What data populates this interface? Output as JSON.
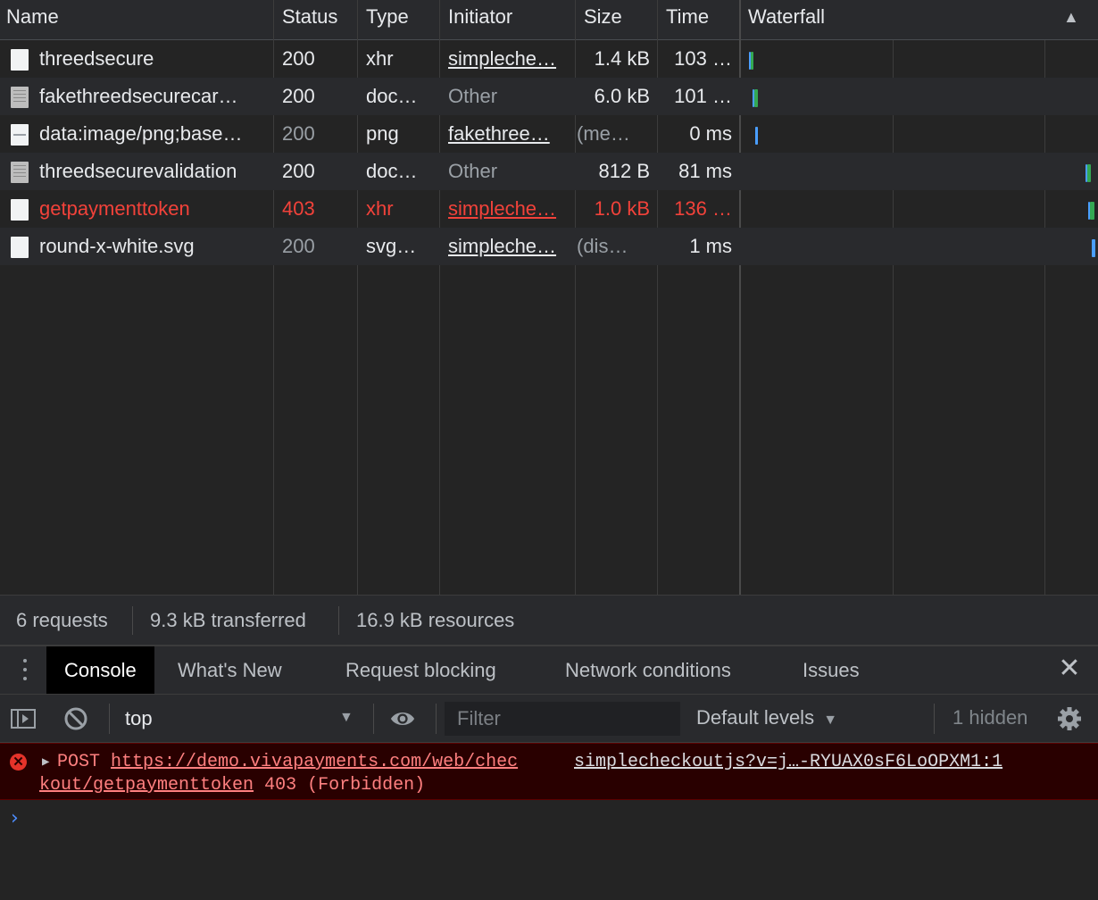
{
  "network": {
    "columns": {
      "name": "Name",
      "status": "Status",
      "type": "Type",
      "initiator": "Initiator",
      "size": "Size",
      "time": "Time",
      "waterfall": "Waterfall"
    },
    "rows": [
      {
        "name": "threedsecure",
        "status": "200",
        "type": "xhr",
        "initiator": "simpleche…",
        "size": "1.4 kB",
        "time": "103 …",
        "icon": "file-icon",
        "state": "normal"
      },
      {
        "name": "fakethreedsecurecar…",
        "status": "200",
        "type": "doc…",
        "initiator": "Other",
        "size": "6.0 kB",
        "time": "101 …",
        "icon": "document-icon",
        "state": "normal"
      },
      {
        "name": "data:image/png;base…",
        "status": "200",
        "type": "png",
        "initiator": "fakethree…",
        "size": "(me…",
        "time": "0 ms",
        "icon": "image-icon",
        "state": "dim"
      },
      {
        "name": "threedsecurevalidation",
        "status": "200",
        "type": "doc…",
        "initiator": "Other",
        "size": "812 B",
        "time": "81 ms",
        "icon": "document-icon",
        "state": "normal"
      },
      {
        "name": "getpaymenttoken",
        "status": "403",
        "type": "xhr",
        "initiator": "simpleche…",
        "size": "1.0 kB",
        "time": "136 …",
        "icon": "file-icon",
        "state": "error"
      },
      {
        "name": "round-x-white.svg",
        "status": "200",
        "type": "svg…",
        "initiator": "simpleche…",
        "size": "(dis…",
        "time": "1 ms",
        "icon": "file-icon",
        "state": "dim"
      }
    ],
    "colors": {
      "waterfall_green": "#34a853",
      "waterfall_blue": "#4a9eff",
      "error_red": "#f2423a"
    }
  },
  "summary": {
    "requests": "6 requests",
    "transferred": "9.3 kB transferred",
    "resources": "16.9 kB resources"
  },
  "drawer": {
    "tabs": [
      "Console",
      "What's New",
      "Request blocking",
      "Network conditions",
      "Issues"
    ],
    "active_tab": "Console",
    "close_icon": "close-icon"
  },
  "console_toolbar": {
    "context": "top",
    "filter_placeholder": "Filter",
    "levels": "Default levels",
    "hidden": "1 hidden"
  },
  "console": {
    "error": {
      "method": "POST",
      "url_part1": "https://demo.vivapayments.com/web/chec",
      "url_part2": "kout/getpaymenttoken",
      "status": "403 (Forbidden)",
      "source": "simplecheckoutjs?v=j…-RYUAX0sF6LoOPXM1:1"
    },
    "prompt_icon": "chevron-right-icon"
  }
}
